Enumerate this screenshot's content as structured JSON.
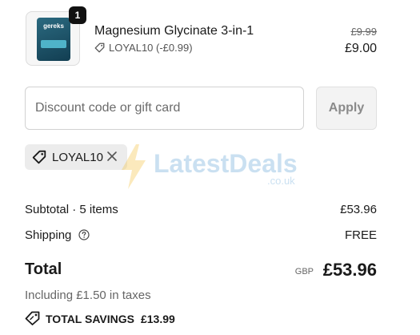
{
  "product": {
    "image_brand_text": "gereks",
    "quantity": "1",
    "name": "Magnesium Glycinate 3-in-1",
    "discount": "LOYAL10 (-£0.99)",
    "original_price": "£9.99",
    "price": "£9.00"
  },
  "discount_form": {
    "placeholder": "Discount code or gift card",
    "apply_label": "Apply"
  },
  "applied_code": {
    "code": "LOYAL10"
  },
  "watermark": {
    "text": "LatestDeals",
    "domain": ".co.uk"
  },
  "summary": {
    "subtotal_label": "Subtotal · 5 items",
    "subtotal_value": "£53.96",
    "shipping_label": "Shipping",
    "shipping_value": "FREE",
    "total_label": "Total",
    "currency": "GBP",
    "total_value": "£53.96",
    "taxes_note": "Including £1.50 in taxes",
    "savings_label": "TOTAL SAVINGS",
    "savings_value": "£13.99"
  },
  "icons": {
    "tag": "tag-icon",
    "close": "close-icon",
    "help": "help-circle-icon",
    "savings": "price-tag-icon"
  },
  "colors": {
    "text": "#1a1a1a",
    "muted": "#666666",
    "chip_bg": "#ececec",
    "apply_bg": "#f3f3f3"
  }
}
